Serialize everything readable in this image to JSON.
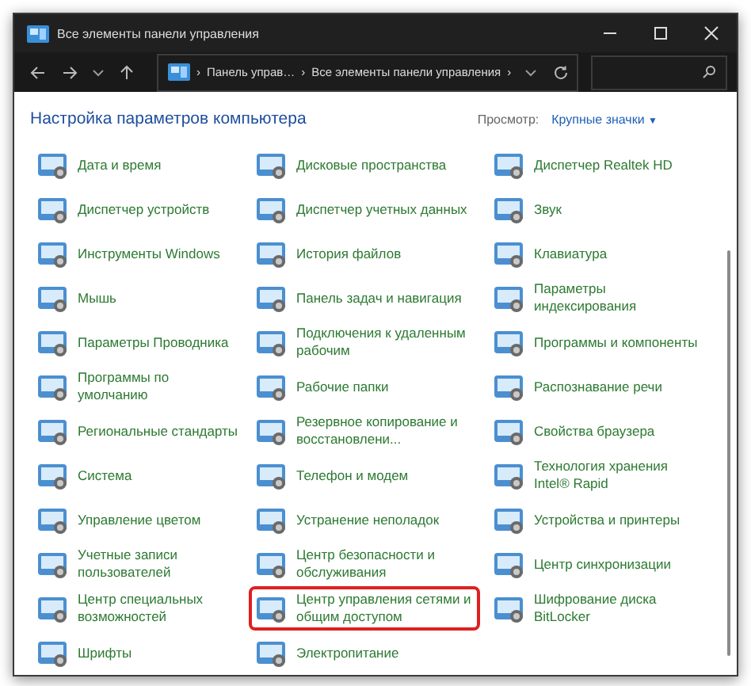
{
  "window": {
    "title": "Все элементы панели управления"
  },
  "address_bar": {
    "separator": "›",
    "path": [
      {
        "label": "Панель управ…"
      },
      {
        "label": "Все элементы панели управления"
      }
    ]
  },
  "header": {
    "title": "Настройка параметров компьютера",
    "view_label": "Просмотр:",
    "view_value": "Крупные значки",
    "view_caret": "▼"
  },
  "columns": [
    {
      "items": [
        {
          "label": "Дата и время",
          "highlighted": false
        },
        {
          "label": "Диспетчер устройств",
          "highlighted": false
        },
        {
          "label": "Инструменты Windows",
          "highlighted": false
        },
        {
          "label": "Мышь",
          "highlighted": false
        },
        {
          "label": "Параметры Проводника",
          "highlighted": false
        },
        {
          "label": "Программы по умолчанию",
          "highlighted": false
        },
        {
          "label": "Региональные стандарты",
          "highlighted": false
        },
        {
          "label": "Система",
          "highlighted": false
        },
        {
          "label": "Управление цветом",
          "highlighted": false
        },
        {
          "label": "Учетные записи пользователей",
          "highlighted": false
        },
        {
          "label": "Центр специальных возможностей",
          "highlighted": false
        },
        {
          "label": "Шрифты",
          "highlighted": false
        }
      ]
    },
    {
      "items": [
        {
          "label": "Дисковые пространства",
          "highlighted": false
        },
        {
          "label": "Диспетчер учетных данных",
          "highlighted": false
        },
        {
          "label": "История файлов",
          "highlighted": false
        },
        {
          "label": "Панель задач и навигация",
          "highlighted": false
        },
        {
          "label": "Подключения к удаленным рабочим",
          "highlighted": false
        },
        {
          "label": "Рабочие папки",
          "highlighted": false
        },
        {
          "label": "Резервное копирование и восстановлени...",
          "highlighted": false
        },
        {
          "label": "Телефон и модем",
          "highlighted": false
        },
        {
          "label": "Устранение неполадок",
          "highlighted": false
        },
        {
          "label": "Центр безопасности и обслуживания",
          "highlighted": false
        },
        {
          "label": "Центр управления сетями и общим доступом",
          "highlighted": true
        },
        {
          "label": "Электропитание",
          "highlighted": false
        }
      ]
    },
    {
      "items": [
        {
          "label": "Диспетчер Realtek HD",
          "highlighted": false
        },
        {
          "label": "Звук",
          "highlighted": false
        },
        {
          "label": "Клавиатура",
          "highlighted": false
        },
        {
          "label": "Параметры индексирования",
          "highlighted": false
        },
        {
          "label": "Программы и компоненты",
          "highlighted": false
        },
        {
          "label": "Распознавание речи",
          "highlighted": false
        },
        {
          "label": "Свойства браузера",
          "highlighted": false
        },
        {
          "label": "Технология хранения Intel® Rapid",
          "highlighted": false
        },
        {
          "label": "Устройства и принтеры",
          "highlighted": false
        },
        {
          "label": "Центр синхронизации",
          "highlighted": false
        },
        {
          "label": "Шифрование диска BitLocker",
          "highlighted": false
        }
      ]
    }
  ]
}
